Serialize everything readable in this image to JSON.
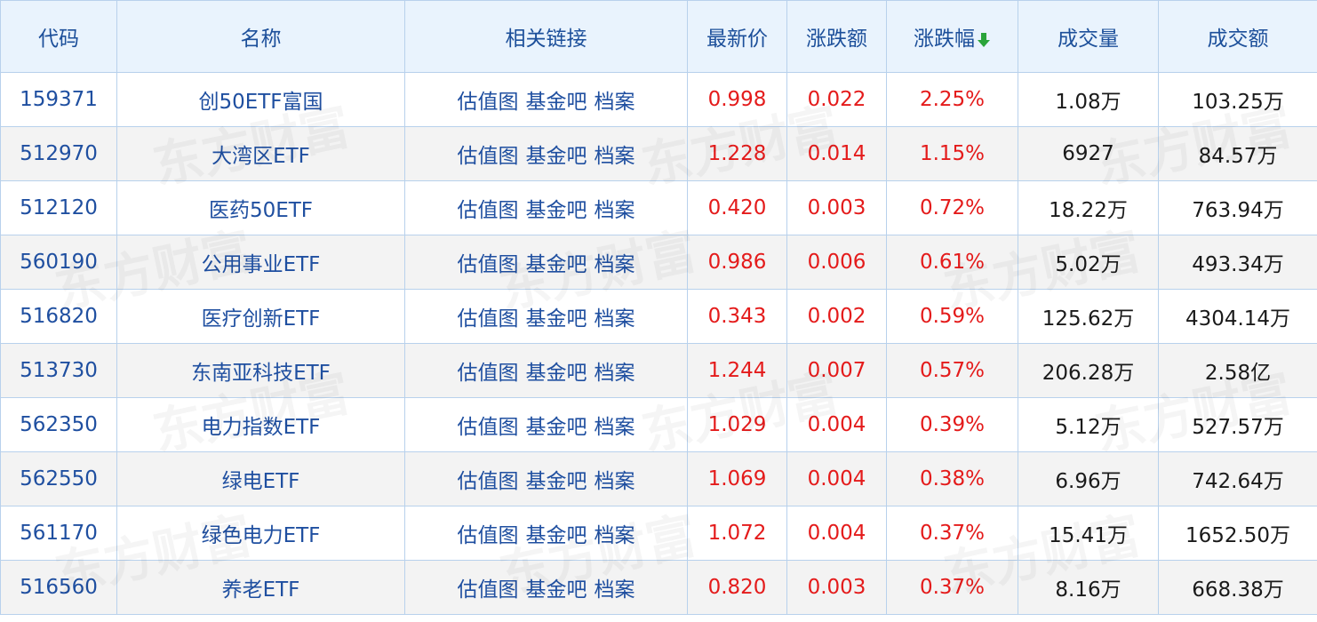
{
  "table": {
    "headers": {
      "code": "代码",
      "name": "名称",
      "links": "相关链接",
      "price": "最新价",
      "change": "涨跌额",
      "change_pct": "涨跌幅",
      "volume": "成交量",
      "amount": "成交额"
    },
    "sort_icon": "arrow-down-icon",
    "colors": {
      "header_bg": "#e9f3fd",
      "blue": "#1f4fa0",
      "red": "#e41b1b",
      "border": "#b8d1ec",
      "stripe": "#f3f3f3"
    },
    "link_labels": [
      "估值图",
      "基金吧",
      "档案"
    ],
    "rows": [
      {
        "code": "159371",
        "name": "创50ETF富国",
        "price": "0.998",
        "change": "0.022",
        "change_pct": "2.25%",
        "volume": "1.08万",
        "amount": "103.25万"
      },
      {
        "code": "512970",
        "name": "大湾区ETF",
        "price": "1.228",
        "change": "0.014",
        "change_pct": "1.15%",
        "volume": "6927",
        "amount": "84.57万"
      },
      {
        "code": "512120",
        "name": "医药50ETF",
        "price": "0.420",
        "change": "0.003",
        "change_pct": "0.72%",
        "volume": "18.22万",
        "amount": "763.94万"
      },
      {
        "code": "560190",
        "name": "公用事业ETF",
        "price": "0.986",
        "change": "0.006",
        "change_pct": "0.61%",
        "volume": "5.02万",
        "amount": "493.34万"
      },
      {
        "code": "516820",
        "name": "医疗创新ETF",
        "price": "0.343",
        "change": "0.002",
        "change_pct": "0.59%",
        "volume": "125.62万",
        "amount": "4304.14万"
      },
      {
        "code": "513730",
        "name": "东南亚科技ETF",
        "price": "1.244",
        "change": "0.007",
        "change_pct": "0.57%",
        "volume": "206.28万",
        "amount": "2.58亿"
      },
      {
        "code": "562350",
        "name": "电力指数ETF",
        "price": "1.029",
        "change": "0.004",
        "change_pct": "0.39%",
        "volume": "5.12万",
        "amount": "527.57万"
      },
      {
        "code": "562550",
        "name": "绿电ETF",
        "price": "1.069",
        "change": "0.004",
        "change_pct": "0.38%",
        "volume": "6.96万",
        "amount": "742.64万"
      },
      {
        "code": "561170",
        "name": "绿色电力ETF",
        "price": "1.072",
        "change": "0.004",
        "change_pct": "0.37%",
        "volume": "15.41万",
        "amount": "1652.50万"
      },
      {
        "code": "516560",
        "name": "养老ETF",
        "price": "0.820",
        "change": "0.003",
        "change_pct": "0.37%",
        "volume": "8.16万",
        "amount": "668.38万"
      }
    ]
  },
  "watermark": "东方财富"
}
